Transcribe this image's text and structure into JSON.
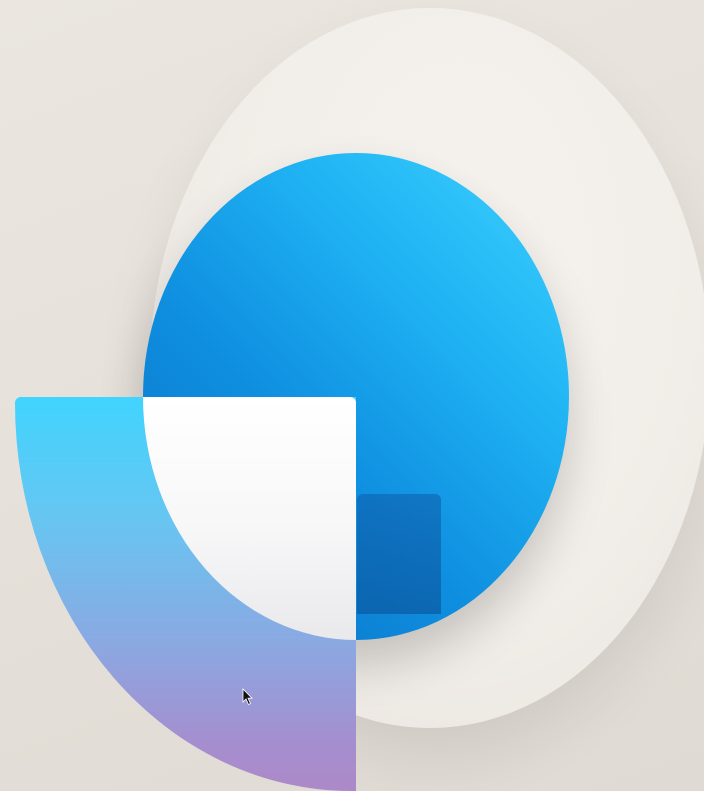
{
  "scene": {
    "description_name": "abstract-logo-artwork",
    "colors": {
      "background": "#e8e3dc",
      "backdrop_ring": "#f3efea",
      "circle_light": "#3fd2ff",
      "circle_dark": "#0a6fc4",
      "card_top": "#40d4fe",
      "card_bottom": "#ad89c8",
      "lens": "#ffffff"
    },
    "icons": [
      "mouse-cursor-icon"
    ]
  }
}
